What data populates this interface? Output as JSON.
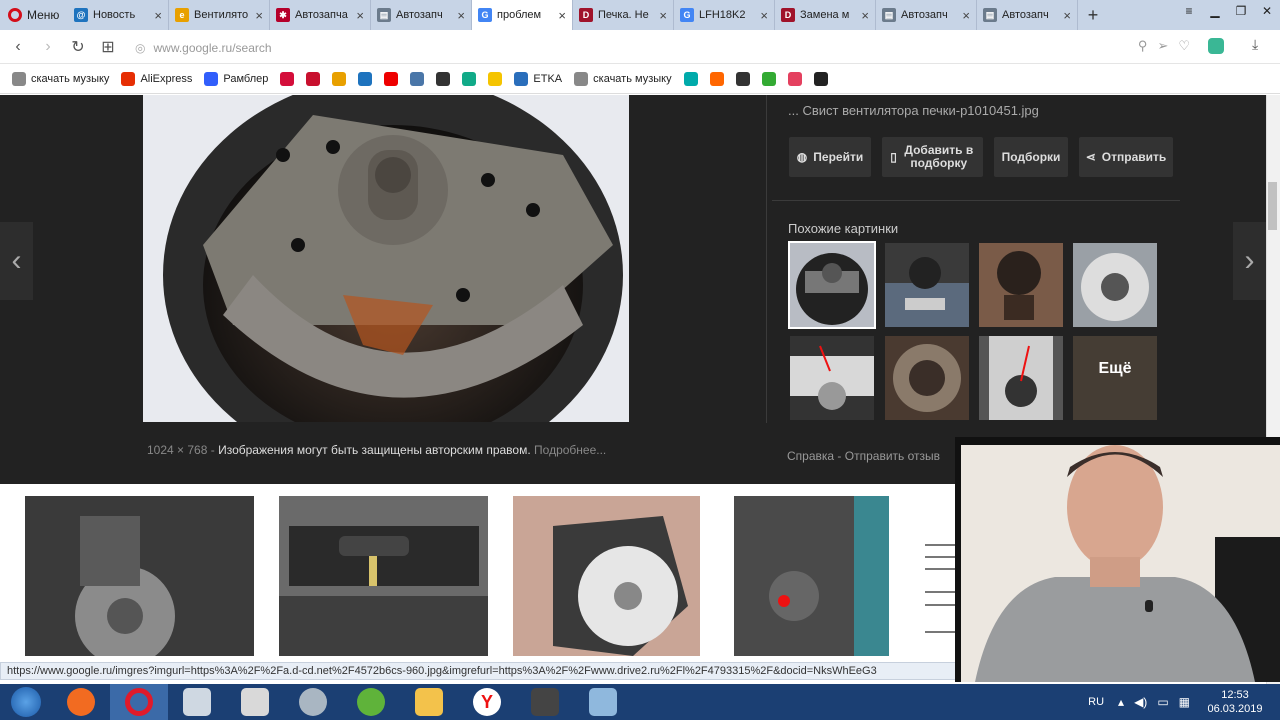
{
  "browser": {
    "menu_label": "Меню",
    "tabs": [
      {
        "label": "Новость",
        "fav_color": "#1e73be",
        "fav_glyph": "@"
      },
      {
        "label": "Вентилято",
        "fav_color": "#e8a000",
        "fav_glyph": "e"
      },
      {
        "label": "Автозапча",
        "fav_color": "#b5002b",
        "fav_glyph": "✱"
      },
      {
        "label": "Автозапч",
        "fav_color": "#6b7b8c",
        "fav_glyph": "▤"
      },
      {
        "label": "проблем",
        "fav_color": "#4285f4",
        "fav_glyph": "G",
        "active": true
      },
      {
        "label": "Печка. Не",
        "fav_color": "#a0132a",
        "fav_glyph": "D"
      },
      {
        "label": "LFH18K2",
        "fav_color": "#4285f4",
        "fav_glyph": "G"
      },
      {
        "label": "Замена м",
        "fav_color": "#a0132a",
        "fav_glyph": "D"
      },
      {
        "label": "Автозапч",
        "fav_color": "#6b7b8c",
        "fav_glyph": "▤"
      },
      {
        "label": "Автозапч",
        "fav_color": "#6b7b8c",
        "fav_glyph": "▤"
      }
    ],
    "new_tab_glyph": "+",
    "url": "www.google.ru/search",
    "bookmarks": [
      {
        "label": "скачать музыку",
        "color": "#888"
      },
      {
        "label": "AliExpress",
        "color": "#e62e04"
      },
      {
        "label": "Рамблер",
        "color": "#315efb"
      },
      {
        "label": "",
        "color": "#d40e3a"
      },
      {
        "label": "",
        "color": "#c8102e"
      },
      {
        "label": "",
        "color": "#e8a000"
      },
      {
        "label": "",
        "color": "#1e73be"
      },
      {
        "label": "",
        "color": "#e00"
      },
      {
        "label": "",
        "color": "#4a76a8"
      },
      {
        "label": "",
        "color": "#333"
      },
      {
        "label": "",
        "color": "#1a8"
      },
      {
        "label": "",
        "color": "#f5c400"
      },
      {
        "label": "ETKA",
        "color": "#2a6ebb"
      },
      {
        "label": "скачать музыку",
        "color": "#888"
      },
      {
        "label": "",
        "color": "#0aa"
      },
      {
        "label": "",
        "color": "#f60"
      },
      {
        "label": "",
        "color": "#333"
      },
      {
        "label": "",
        "color": "#3a3"
      },
      {
        "label": "",
        "color": "#e4405f"
      },
      {
        "label": "",
        "color": "#222"
      }
    ]
  },
  "viewer": {
    "image_title": "... Свист вентилятора печки-p1010451.jpg",
    "buttons": {
      "visit": "Перейти",
      "save": "Добавить в подборку",
      "collections": "Подборки",
      "share": "Отправить"
    },
    "related_title": "Похожие картинки",
    "more_label": "Ещё",
    "dimensions": "1024 × 768",
    "copyright": "Изображения могут быть защищены авторским правом.",
    "learn_more": "Подробнее...",
    "footer_help": "Справка",
    "footer_sep": "-",
    "footer_feedback": "Отправить отзыв"
  },
  "status_url": "https://www.google.ru/imgres?imgurl=https%3A%2F%2Fa.d-cd.net%2F4572b6cs-960.jpg&imgrefurl=https%3A%2F%2Fwww.drive2.ru%2Fl%2F4793315%2F&docid=NksWhEeG3",
  "taskbar": {
    "lang": "RU",
    "time": "12:53",
    "date": "06.03.2019"
  },
  "colors": {
    "accent": "#4285f4",
    "dark_panel": "#222222",
    "taskbar": "#1b3f73"
  }
}
